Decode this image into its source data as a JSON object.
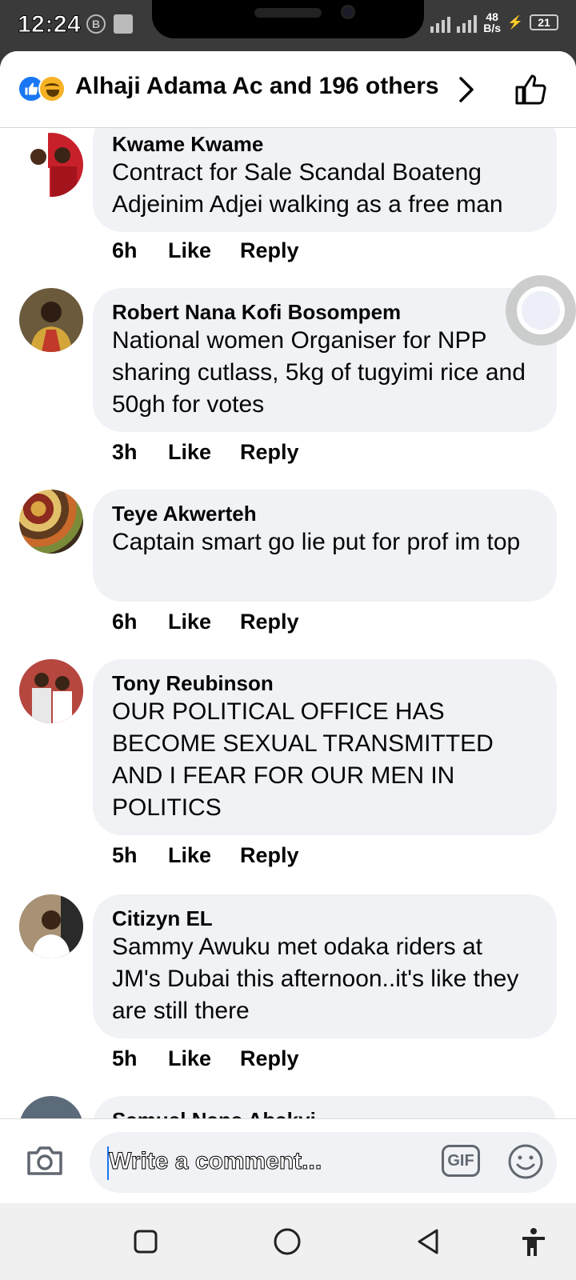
{
  "status_bar": {
    "time": "12:24",
    "net_speed_value": "48",
    "net_speed_unit": "B/s",
    "network_type": "3G",
    "battery": "21"
  },
  "reactions": {
    "summary": "Alhaji Adama Ac and 196 others"
  },
  "comments": [
    {
      "author": "Kwame Kwame",
      "text": "Contract for Sale Scandal Boateng Adjeinim Adjei walking as a free man",
      "time": "6h",
      "like": "Like",
      "reply": "Reply"
    },
    {
      "author": "Robert Nana Kofi Bosompem",
      "text": "National women Organiser for NPP sharing cutlass, 5kg of tugyimi rice and 50gh for votes",
      "time": "3h",
      "like": "Like",
      "reply": "Reply"
    },
    {
      "author": "Teye Akwerteh",
      "text": "Captain smart go lie put for prof im top",
      "time": "6h",
      "like": "Like",
      "reply": "Reply"
    },
    {
      "author": "Tony Reubinson",
      "text": "OUR POLITICAL OFFICE HAS BECOME SEXUAL TRANSMITTED AND I FEAR FOR OUR MEN IN POLITICS",
      "time": "5h",
      "like": "Like",
      "reply": "Reply"
    },
    {
      "author": "Citizyn EL",
      "text": "Sammy Awuku met odaka riders at JM's Dubai this afternoon..it's like they are still there",
      "time": "5h",
      "like": "Like",
      "reply": "Reply"
    },
    {
      "author": "Samuel Nana Abakyi",
      "text": "",
      "time": "",
      "like": "",
      "reply": ""
    }
  ],
  "composer": {
    "placeholder": "Write a comment...",
    "gif_label": "GIF"
  },
  "colors": {
    "brand_blue": "#1877f2",
    "bubble_bg": "#f0f2f5"
  }
}
